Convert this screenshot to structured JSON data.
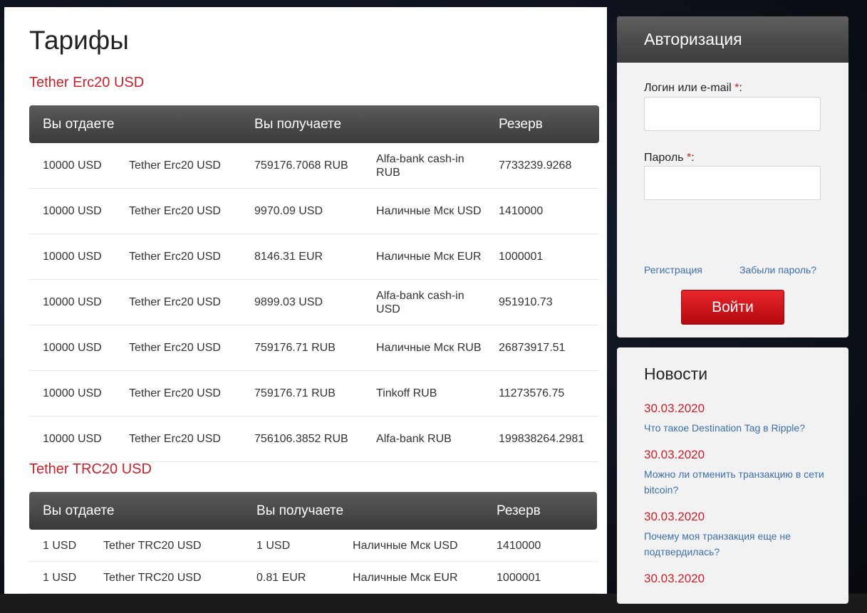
{
  "page": {
    "title": "Тарифы"
  },
  "tables": [
    {
      "section_title": "Tether Erc20 USD",
      "headers": {
        "give": "Вы отдаете",
        "receive": "Вы получаете",
        "reserve": "Резерв"
      },
      "rows": [
        {
          "give_amount": "10000 USD",
          "give_currency": "Tether Erc20 USD",
          "receive_amount": "759176.7068 RUB",
          "receive_currency": "Alfa-bank cash-in RUB",
          "reserve": "7733239.9268"
        },
        {
          "give_amount": "10000 USD",
          "give_currency": "Tether Erc20 USD",
          "receive_amount": "9970.09 USD",
          "receive_currency": "Наличные Мск USD",
          "reserve": "1410000"
        },
        {
          "give_amount": "10000 USD",
          "give_currency": "Tether Erc20 USD",
          "receive_amount": "8146.31 EUR",
          "receive_currency": "Наличные Мск EUR",
          "reserve": "1000001"
        },
        {
          "give_amount": "10000 USD",
          "give_currency": "Tether Erc20 USD",
          "receive_amount": "9899.03 USD",
          "receive_currency": "Alfa-bank cash-in USD",
          "reserve": "951910.73"
        },
        {
          "give_amount": "10000 USD",
          "give_currency": "Tether Erc20 USD",
          "receive_amount": "759176.71 RUB",
          "receive_currency": "Наличные Мск RUB",
          "reserve": "26873917.51"
        },
        {
          "give_amount": "10000 USD",
          "give_currency": "Tether Erc20 USD",
          "receive_amount": "759176.71 RUB",
          "receive_currency": "Tinkoff RUB",
          "reserve": "11273576.75"
        },
        {
          "give_amount": "10000 USD",
          "give_currency": "Tether Erc20 USD",
          "receive_amount": "756106.3852 RUB",
          "receive_currency": "Alfa-bank RUB",
          "reserve": "199838264.2981"
        }
      ]
    },
    {
      "section_title": "Tether TRC20 USD",
      "headers": {
        "give": "Вы отдаете",
        "receive": "Вы получаете",
        "reserve": "Резерв"
      },
      "rows": [
        {
          "give_amount": "1 USD",
          "give_currency": "Tether TRC20 USD",
          "receive_amount": "1 USD",
          "receive_currency": "Наличные Мск USD",
          "reserve": "1410000"
        },
        {
          "give_amount": "1 USD",
          "give_currency": "Tether TRC20 USD",
          "receive_amount": "0.81 EUR",
          "receive_currency": "Наличные Мск EUR",
          "reserve": "1000001"
        }
      ]
    }
  ],
  "auth": {
    "title": "Авторизация",
    "login_label": "Логин или e-mail",
    "password_label": "Пароль",
    "required_mark": "*",
    "label_suffix": ":",
    "login_value": "",
    "password_value": "",
    "register_link": "Регистрация",
    "forgot_link": "Забыли пароль?",
    "submit_label": "Войти"
  },
  "news": {
    "title": "Новости",
    "items": [
      {
        "date": "30.03.2020",
        "text": "Что такое Destination Tag в Ripple?"
      },
      {
        "date": "30.03.2020",
        "text": "Можно ли отменить транзакцию в сети bitcoin?"
      },
      {
        "date": "30.03.2020",
        "text": "Почему моя транзакция еще не подтвердилась?"
      },
      {
        "date": "30.03.2020",
        "text": ""
      }
    ]
  },
  "colors": {
    "accent_red": "#c8202b",
    "link_blue": "#3d6fa8",
    "header_dark": "#3a3a3a"
  }
}
